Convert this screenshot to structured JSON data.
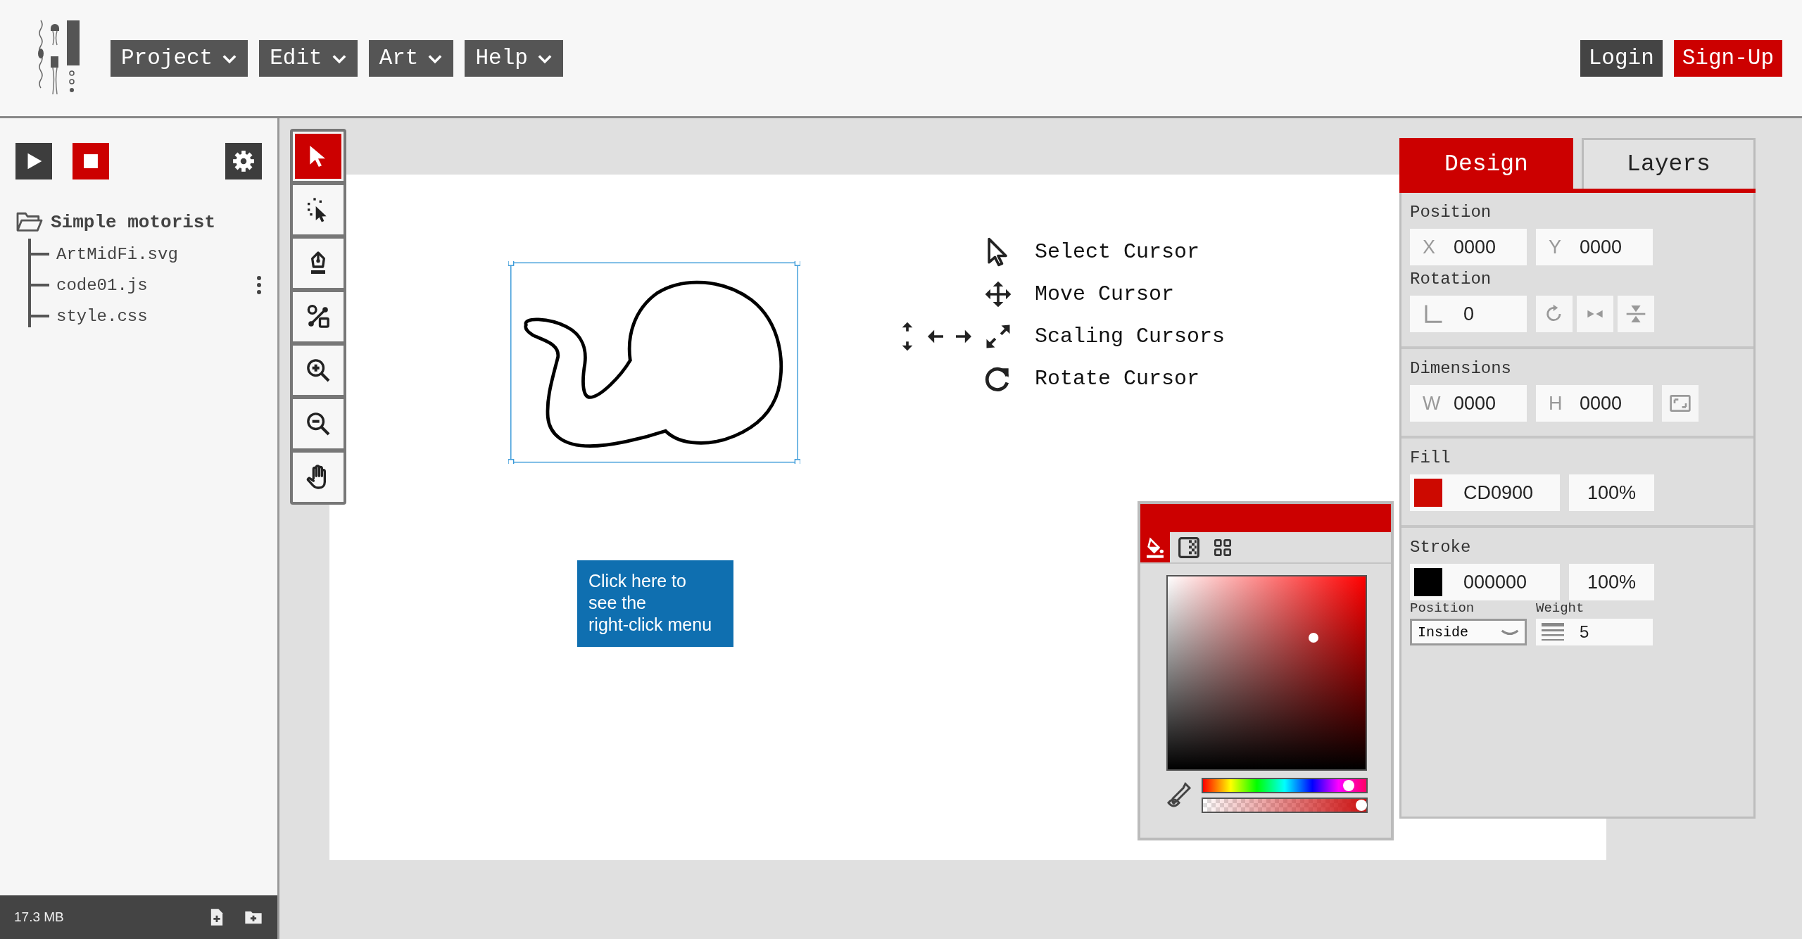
{
  "header": {
    "menus": [
      {
        "label": "Project"
      },
      {
        "label": "Edit"
      },
      {
        "label": "Art"
      },
      {
        "label": "Help"
      }
    ],
    "auth": [
      {
        "label": "Login",
        "kind": "secondary"
      },
      {
        "label": "Sign-Up",
        "kind": "primary"
      }
    ]
  },
  "sidebar": {
    "project": {
      "label": "Simple motorist",
      "expanded": true,
      "children": [
        {
          "label": "ArtMidFi.svg",
          "menu_icon": false
        },
        {
          "label": "code01.js",
          "menu_icon": true
        },
        {
          "label": "style.css",
          "menu_icon": false
        }
      ]
    }
  },
  "status_bar": {
    "memory": "17.3 MB"
  },
  "tools": [
    {
      "kind": "select",
      "selected": true
    },
    {
      "kind": "direct",
      "selected": false
    },
    {
      "kind": "pen",
      "selected": false
    },
    {
      "kind": "node",
      "selected": false
    },
    {
      "kind": "zoom-in",
      "selected": false
    },
    {
      "kind": "zoom-out",
      "selected": false
    },
    {
      "kind": "hand",
      "selected": false
    }
  ],
  "canvas": {
    "legend": [
      {
        "kind": "select",
        "label": "Select Cursor"
      },
      {
        "kind": "move",
        "label": "Move Cursor"
      },
      {
        "kind": "scale",
        "label": "Scaling Cursors"
      },
      {
        "kind": "rotate",
        "label": "Rotate Cursor"
      }
    ],
    "callout": "Click here to\nsee the\nright-click menu"
  },
  "color_picker": {
    "tabs": [
      {
        "kind": "fill",
        "selected": true
      },
      {
        "kind": "opacity",
        "selected": false
      },
      {
        "kind": "swatches",
        "selected": false
      }
    ],
    "hue": {
      "level": 0.9
    },
    "alpha": {
      "level": 0.98
    }
  },
  "panel": {
    "tabs": [
      {
        "label": "Design",
        "selected": true
      },
      {
        "label": "Layers",
        "selected": false
      }
    ],
    "sections": [
      {
        "groups": [
          {
            "title": "Position",
            "fields": [
              {
                "kind": "field",
                "label": "X",
                "value": "0000"
              },
              {
                "kind": "field",
                "label": "Y",
                "value": "0000"
              }
            ]
          },
          {
            "title": "Rotation",
            "fields": [
              {
                "kind": "angle",
                "value": "0"
              },
              {
                "kind": "rotate"
              },
              {
                "kind": "flip-h"
              },
              {
                "kind": "flip-v"
              }
            ]
          }
        ]
      },
      {
        "groups": [
          {
            "title": "Dimensions",
            "fields": [
              {
                "kind": "field",
                "label": "W",
                "value": "0000"
              },
              {
                "kind": "field",
                "label": "H",
                "value": "0000"
              },
              {
                "kind": "fit"
              }
            ]
          }
        ]
      },
      {
        "groups": [
          {
            "title": "Fill",
            "fields": [
              {
                "kind": "color",
                "color": "#cd0900",
                "value": "CD0900"
              },
              {
                "kind": "value",
                "value": "100%"
              }
            ]
          }
        ]
      },
      {
        "groups": [
          {
            "title": "Stroke",
            "fields": [
              {
                "kind": "color",
                "color": "#000000",
                "value": "000000"
              },
              {
                "kind": "value",
                "value": "100%"
              }
            ]
          },
          {
            "fields": [
              {
                "kind": "select",
                "caption": "Position",
                "value": "Inside"
              },
              {
                "kind": "weight",
                "caption": "Weight",
                "value": "5"
              }
            ]
          }
        ]
      }
    ]
  }
}
